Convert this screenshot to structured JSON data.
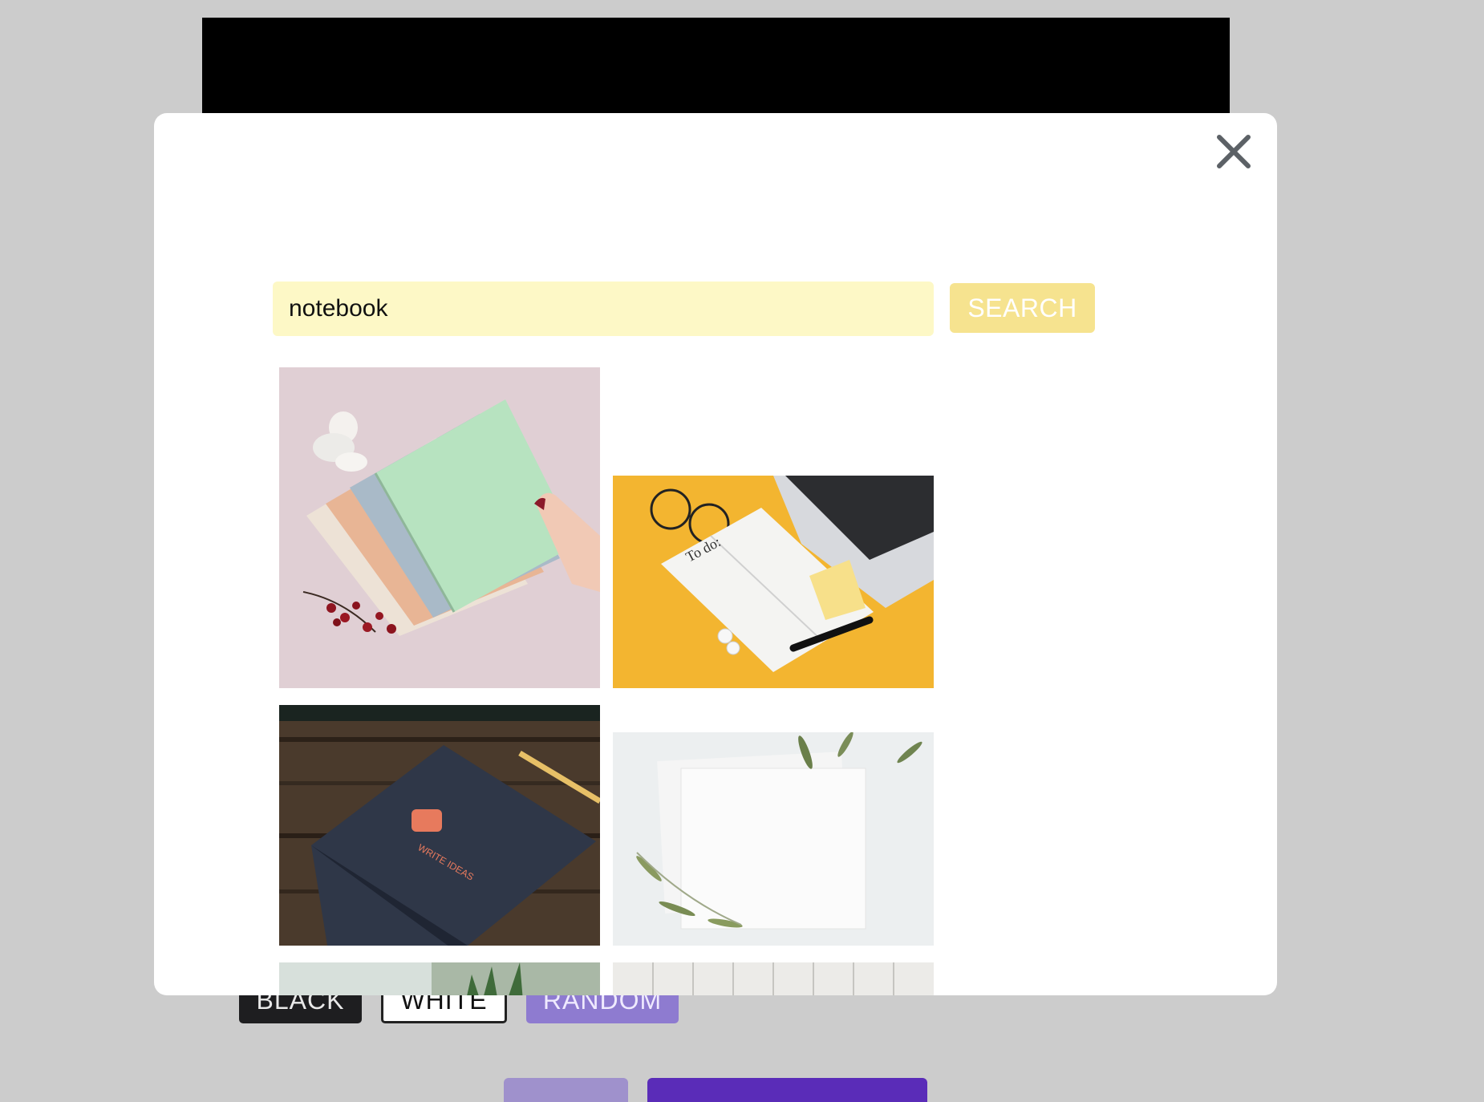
{
  "background": {
    "color_buttons": {
      "black": "BLACK",
      "white": "WHITE",
      "random": "RANDOM"
    },
    "accent_colors": {
      "random": "#8e7bd0",
      "primary": "#5a2cb8"
    }
  },
  "modal": {
    "close_icon": "close-icon",
    "search": {
      "value": "notebook",
      "button_label": "SEARCH"
    },
    "results": [
      {
        "name": "pastel-notebooks-photo"
      },
      {
        "name": "todo-notebook-yellow-desk-photo",
        "text": "To do:"
      },
      {
        "name": "dark-notebook-write-ideas-photo",
        "text": "WRITE IDEAS"
      },
      {
        "name": "blank-paper-leaves-photo"
      },
      {
        "name": "plant-photo-partial"
      },
      {
        "name": "white-wall-photo-partial"
      }
    ]
  }
}
